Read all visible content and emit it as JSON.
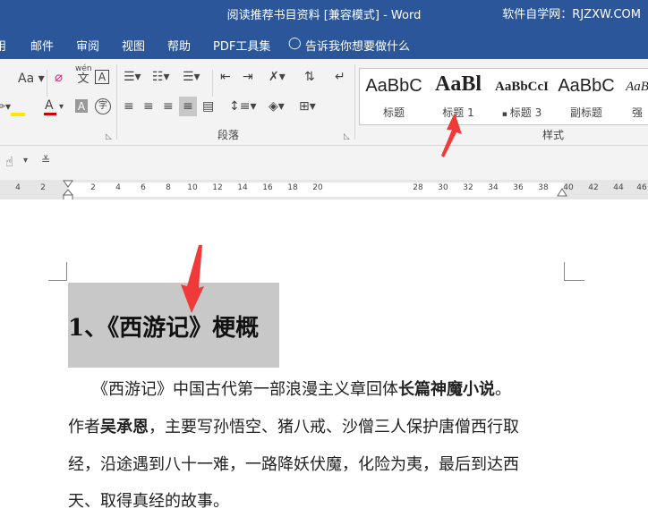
{
  "titlebar": {
    "title": "阅读推荐书目资料 [兼容模式]  -  Word",
    "watermark": "软件自学网：RJZXW.COM"
  },
  "menu": {
    "items": [
      "用",
      "邮件",
      "审阅",
      "视图",
      "帮助",
      "PDF工具集"
    ],
    "tellme": "告诉我你想要做什么"
  },
  "ribbon": {
    "font_group": {
      "aa": "Aa",
      "phonetic_top": "wén",
      "phonetic_char": "文",
      "boxed_a": "A",
      "char_border": "A",
      "encircled": "字"
    },
    "paragraph_label": "段落",
    "styles_label": "样式",
    "styles": [
      {
        "sample": "AaBbC",
        "label": "标题"
      },
      {
        "sample": "AaBl",
        "label": "标题 1"
      },
      {
        "sample": "AaBbCcI",
        "label": "标题 3"
      },
      {
        "sample": "AaBbC",
        "label": "副标题"
      },
      {
        "sample": "AaB",
        "label": "强"
      }
    ]
  },
  "ruler": {
    "ticks": [
      "4",
      "2",
      "2",
      "4",
      "6",
      "8",
      "10",
      "12",
      "14",
      "16",
      "18",
      "20",
      "28",
      "30",
      "32",
      "34",
      "36",
      "38",
      "40",
      "42",
      "44",
      "46"
    ]
  },
  "document": {
    "heading": "1、《西游记》梗概",
    "lines": [
      {
        "pre": "　　《西游记》中国古代第一部浪漫主义章回体",
        "bold": "长篇神魔小说",
        "post": "。"
      },
      {
        "pre": "作者",
        "bold": "吴承恩",
        "post": "，主要写孙悟空、猪八戒、沙僧三人保护唐僧西行取"
      },
      {
        "pre": "经，沿途遇到八十一难，一路降妖伏魔，化险为夷，最后到达西",
        "bold": "",
        "post": ""
      },
      {
        "pre": "天、取得真经的故事。",
        "bold": "",
        "post": ""
      }
    ]
  },
  "colors": {
    "accent": "#2b579a",
    "arrow": "#f03a3a",
    "highlight": "#c8c8c8"
  }
}
